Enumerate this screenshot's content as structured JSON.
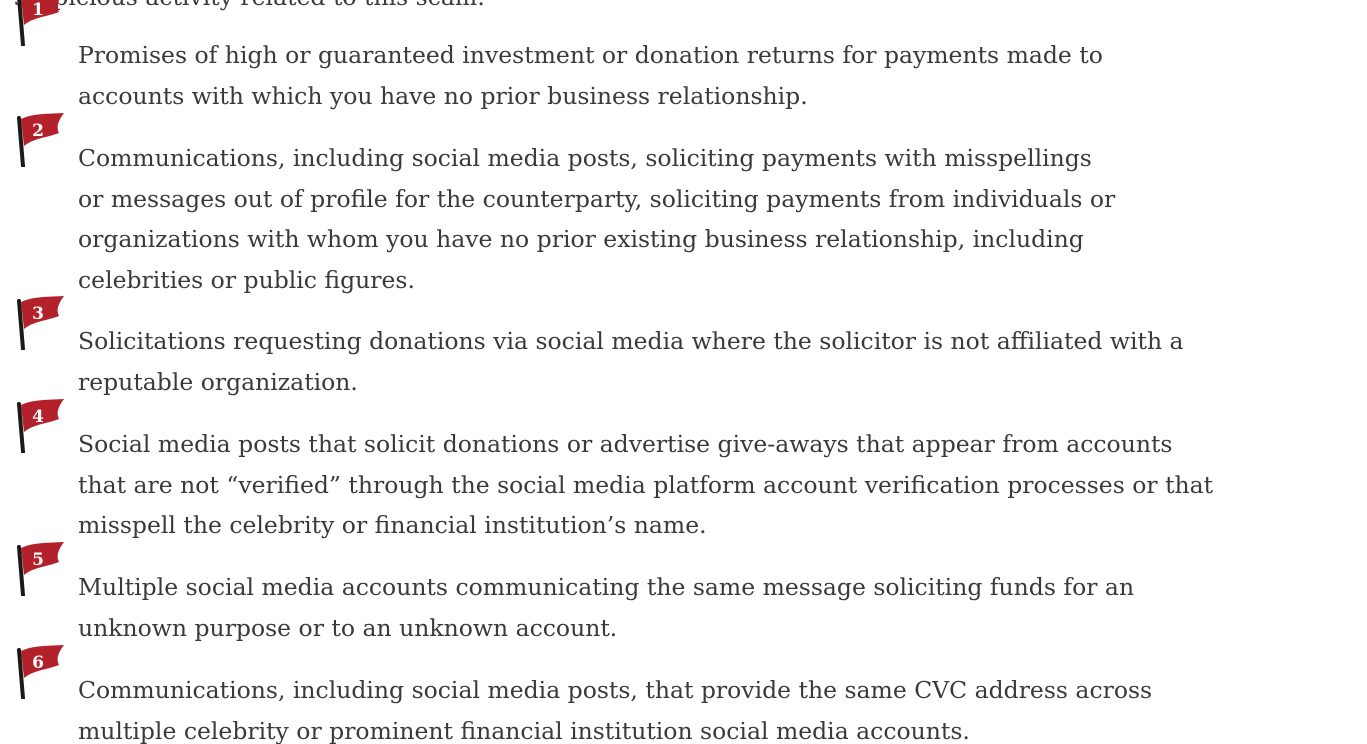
{
  "intro": {
    "text": "suspicious activity related to this scam:"
  },
  "theme": {
    "flag_color": "#b3212b",
    "flag_number_color": "#ffffff",
    "pole_color": "#1a1a1a",
    "text_color": "#3a3a3a"
  },
  "items": [
    {
      "number": "1",
      "lines": [
        "Promises of high or guaranteed investment or donation returns for payments made to",
        "accounts with which you have no prior business relationship."
      ]
    },
    {
      "number": "2",
      "lines": [
        "Communications, including social media posts, soliciting payments with misspellings",
        "or messages out of profile for the counterparty, soliciting payments from individuals or",
        "organizations with whom you have no prior existing business relationship, including",
        "celebrities or public figures."
      ]
    },
    {
      "number": "3",
      "lines": [
        "Solicitations requesting donations via social media where the solicitor is not affiliated with a",
        "reputable organization."
      ]
    },
    {
      "number": "4",
      "lines": [
        "Social media posts that solicit donations or advertise give-aways that appear from accounts",
        "that are not “verified” through the social media platform account verification processes or that",
        "misspell the celebrity or financial institution’s name."
      ]
    },
    {
      "number": "5",
      "lines": [
        "Multiple social media accounts communicating the same message soliciting funds for an",
        "unknown purpose or to an unknown account."
      ]
    },
    {
      "number": "6",
      "lines": [
        "Communications, including social media posts, that provide the same CVC address across",
        "multiple celebrity or prominent financial institution social media accounts."
      ]
    }
  ]
}
